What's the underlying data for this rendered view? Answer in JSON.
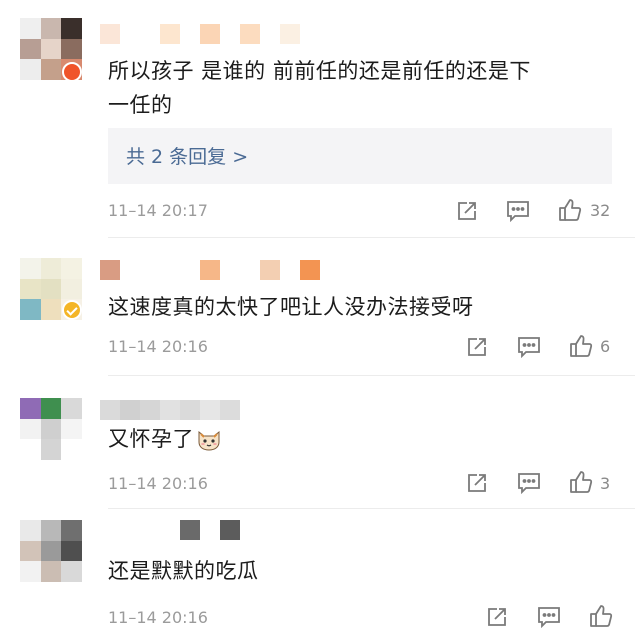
{
  "comments": [
    {
      "text_line1": "所以孩子 是谁的 前前任的还是前任的还是下",
      "text_line2": "一任的",
      "replies_label": "共 2 条回复 >",
      "time": "11–14 20:17",
      "likes": "32"
    },
    {
      "text": "这速度真的太快了吧让人没办法接受呀",
      "time": "11–14 20:16",
      "likes": "6"
    },
    {
      "text": "又怀孕了",
      "time": "11–14 20:16",
      "likes": "3"
    },
    {
      "text": "还是默默的吃瓜",
      "time": "11–14 20:16",
      "likes": ""
    }
  ],
  "colors": {
    "text": "#1c1c1c",
    "link": "#4a6a94",
    "meta": "#9b9b9b",
    "reply_bg": "#f4f4f6",
    "icon": "#7a7a7a"
  },
  "icons": [
    "share-icon",
    "comment-icon",
    "like-icon"
  ]
}
